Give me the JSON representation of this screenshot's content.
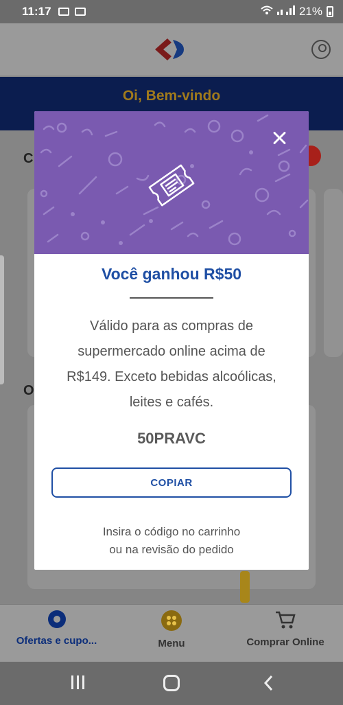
{
  "status_bar": {
    "time": "11:17",
    "battery": "21%"
  },
  "welcome": {
    "greeting": "Oi, Bem-vindo"
  },
  "background": {
    "letter_1": "C",
    "letter_2": "O"
  },
  "modal": {
    "title": "Você ganhou R$50",
    "description": "Válido para as compras de supermercado online acima de R$149. Exceto bebidas alcoólicas, leites e cafés.",
    "code": "50PRAVC",
    "copy_label": "COPIAR",
    "hint_line1": "Insira o código no carrinho",
    "hint_line2": "ou na revisão do pedido"
  },
  "bottom_nav": {
    "ofertas": "Ofertas e cupo...",
    "menu": "Menu",
    "comprar": "Comprar Online"
  },
  "colors": {
    "modal_header": "#7a5ab0",
    "brand_blue": "#1f4fa4",
    "welcome_text": "#a07a1c"
  },
  "icons": [
    "carrefour-logo",
    "account-icon",
    "close-icon",
    "ticket-icon",
    "offers-icon",
    "menu-icon",
    "cart-icon",
    "recents-icon",
    "home-icon",
    "back-icon"
  ]
}
